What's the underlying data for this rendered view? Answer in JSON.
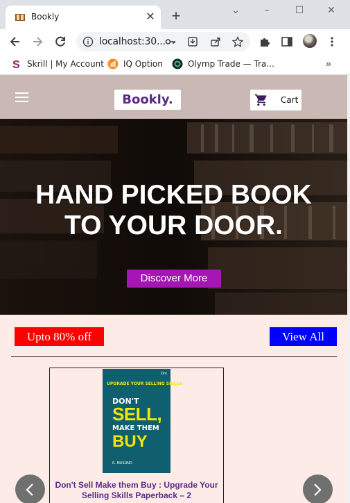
{
  "browser": {
    "tab_title": "Bookly",
    "url": "localhost:30...",
    "bookmarks": [
      {
        "label": "Skrill | My Account",
        "icon": "skrill-icon"
      },
      {
        "label": "IQ Option",
        "icon": "iqoption-icon"
      },
      {
        "label": "Olymp Trade — Tra...",
        "icon": "olymptrade-icon"
      }
    ],
    "more_bookmarks": "»"
  },
  "site": {
    "logo": "Bookly.",
    "cart_label": "Cart",
    "hero_title_line1": "HAND PICKED BOOK",
    "hero_title_line2": "TO YOUR DOOR.",
    "discover_button": "Discover More",
    "offer_badge": "Upto 80% off",
    "view_all": "View All",
    "book": {
      "cover_tagline": "UPGRADE YOUR SELLING SKILLS",
      "cover_publisher": "Om",
      "cover_line1": "DON'T",
      "cover_line2": "SELL,",
      "cover_line3": "MAKE THEM",
      "cover_line4": "BUY",
      "cover_author": "R. MUKUND",
      "title": "Don't Sell Make them Buy : Upgrade Your Selling Skills Paperback – 2"
    }
  },
  "colors": {
    "header_bg": "#c9b8b4",
    "page_bg": "#fdebe8",
    "accent_purple": "#a516b4",
    "logo_text": "#5b2a86",
    "badge_red": "#ff0000",
    "badge_blue": "#0000ff"
  }
}
